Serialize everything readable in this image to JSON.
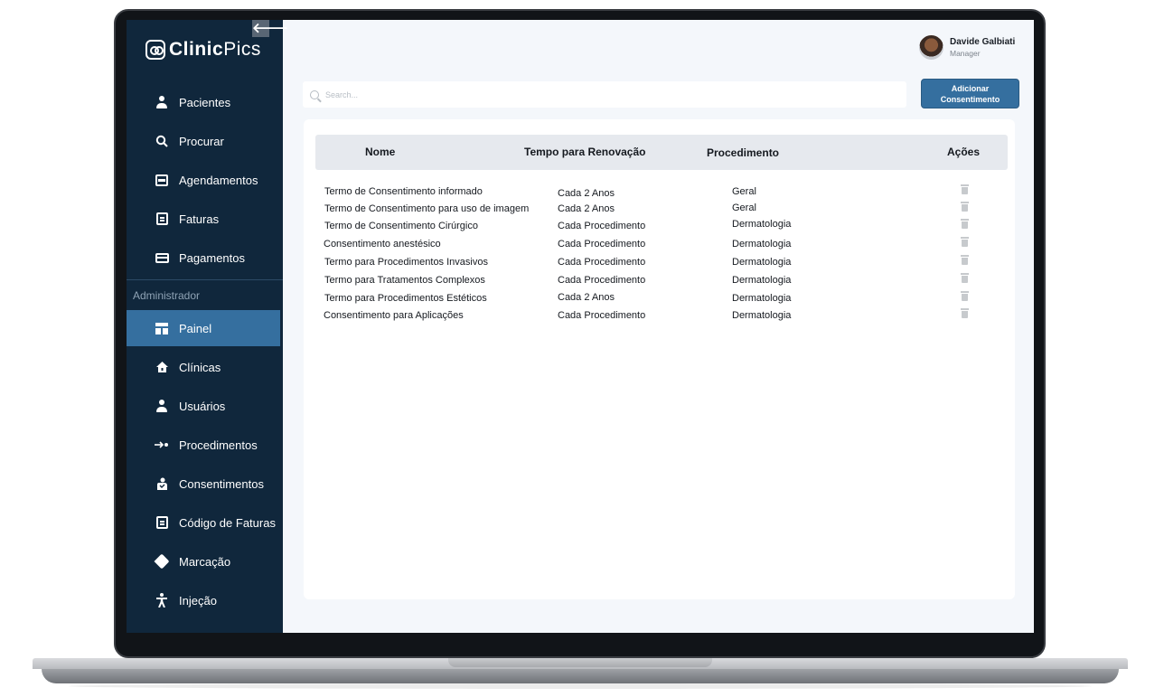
{
  "app": {
    "brand_bold": "Clinic",
    "brand_light": "Pics"
  },
  "sidebar": {
    "collapse_glyph": "🡐",
    "items": [
      {
        "label": "Pacientes",
        "icon": "patient-icon"
      },
      {
        "label": "Procurar",
        "icon": "search-icon"
      },
      {
        "label": "Agendamentos",
        "icon": "calendar-icon"
      },
      {
        "label": "Faturas",
        "icon": "invoice-icon"
      },
      {
        "label": "Pagamentos",
        "icon": "payment-card-icon"
      }
    ],
    "admin_section_label": "Administrador",
    "admin_items": [
      {
        "label": "Painel",
        "icon": "dashboard-icon",
        "active": true
      },
      {
        "label": "Clínicas",
        "icon": "clinic-house-icon"
      },
      {
        "label": "Usuários",
        "icon": "user-icon"
      },
      {
        "label": "Procedimentos",
        "icon": "procedure-arrow-icon"
      },
      {
        "label": "Consentimentos",
        "icon": "consent-hand-icon"
      },
      {
        "label": "Código de Faturas",
        "icon": "invoice-code-icon"
      },
      {
        "label": "Marcação",
        "icon": "tag-icon"
      },
      {
        "label": "Injeção",
        "icon": "injection-person-icon"
      }
    ]
  },
  "header": {
    "user_name": "Davide Galbiati",
    "user_role": "Manager"
  },
  "search": {
    "placeholder": "Search..."
  },
  "actions": {
    "add_line1": "Adicionar",
    "add_line2": "Consentimento"
  },
  "table": {
    "columns": [
      "Nome",
      "Tempo para Renovação",
      "Procedimento",
      "Ações"
    ],
    "rows": [
      {
        "nome": "Termo de Consentimento informado",
        "tempo": "Cada 2 Anos",
        "procedimento": "Geral"
      },
      {
        "nome": "Termo de Consentimento para uso de imagem",
        "tempo": "Cada 2 Anos",
        "procedimento": "Geral"
      },
      {
        "nome": "Termo de Consentimento Cirúrgico",
        "tempo": "Cada Procedimento",
        "procedimento": "Dermatologia"
      },
      {
        "nome": "Consentimento anestésico",
        "tempo": "Cada Procedimento",
        "procedimento": "Dermatologia"
      },
      {
        "nome": "Termo para Procedimentos Invasivos",
        "tempo": "Cada Procedimento",
        "procedimento": "Dermatologia"
      },
      {
        "nome": "Termo para Tratamentos Complexos",
        "tempo": "Cada Procedimento",
        "procedimento": "Dermatologia"
      },
      {
        "nome": "Termo para Procedimentos Estéticos",
        "tempo": "Cada 2 Anos",
        "procedimento": "Dermatologia"
      },
      {
        "nome": "Consentimento para Aplicações",
        "tempo": "Cada Procedimento",
        "procedimento": "Dermatologia"
      }
    ]
  },
  "colors": {
    "sidebar_bg": "#10273c",
    "accent": "#356f9f",
    "main_bg": "#f4f7fb"
  }
}
